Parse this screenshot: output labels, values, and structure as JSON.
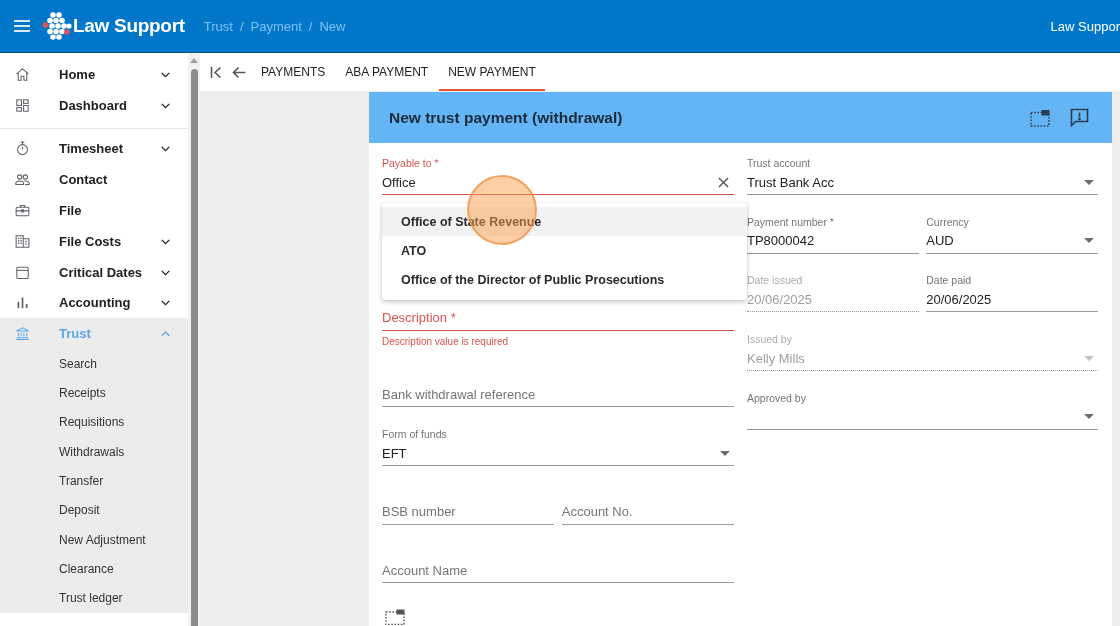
{
  "header": {
    "app_name": "Law Support",
    "breadcrumb": [
      {
        "label": "Trust",
        "separator": "/"
      },
      {
        "label": "Payment",
        "separator": "/"
      },
      {
        "label": "New"
      }
    ],
    "user": "Law Suppor"
  },
  "sidebar": {
    "sections": [
      {
        "items": [
          {
            "label": "Home",
            "expandable": true,
            "expanded": false,
            "selected": false
          },
          {
            "label": "Dashboard",
            "expandable": true,
            "expanded": false,
            "selected": false
          }
        ]
      },
      {
        "items": [
          {
            "label": "Timesheet",
            "expandable": true,
            "expanded": false,
            "selected": false
          },
          {
            "label": "Contact",
            "expandable": false,
            "expanded": false,
            "selected": false
          },
          {
            "label": "File",
            "expandable": false,
            "expanded": false,
            "selected": false
          },
          {
            "label": "File Costs",
            "expandable": true,
            "expanded": false,
            "selected": false
          },
          {
            "label": "Critical Dates",
            "expandable": true,
            "expanded": false,
            "selected": false
          },
          {
            "label": "Accounting",
            "expandable": true,
            "expanded": false,
            "selected": false
          },
          {
            "label": "Trust",
            "expandable": true,
            "expanded": true,
            "selected": true,
            "children": [
              {
                "label": "Search",
                "selected": false
              },
              {
                "label": "Receipts",
                "selected": false
              },
              {
                "label": "Requisitions",
                "selected": false
              },
              {
                "label": "Withdrawals",
                "selected": false
              },
              {
                "label": "Transfer",
                "selected": false
              },
              {
                "label": "Deposit",
                "selected": false
              },
              {
                "label": "New Adjustment",
                "selected": false
              },
              {
                "label": "Clearance",
                "selected": false
              },
              {
                "label": "Trust ledger",
                "selected": false
              }
            ]
          }
        ]
      }
    ]
  },
  "tabs": [
    {
      "label": "PAYMENTS",
      "selected": false
    },
    {
      "label": "ABA PAYMENT",
      "selected": false
    },
    {
      "label": "NEW PAYMENT",
      "selected": true
    }
  ],
  "form": {
    "title": "New trust payment (withdrawal)",
    "columns": [
      {
        "rows": [
          {
            "fields": [
              {
                "kind": "autocomplete",
                "label": "Payable to *",
                "value": "Office",
                "invalid": true,
                "disabled": false,
                "suggestions": [
                  {
                    "label": "Office of State Revenue",
                    "selected": true
                  },
                  {
                    "label": "ATO",
                    "selected": false
                  },
                  {
                    "label": "Office of the Director of Public Prosecutions",
                    "selected": false
                  }
                ]
              }
            ]
          },
          {
            "fields": [
              {
                "kind": "text",
                "placeholder": "Description *",
                "error": "Description value is required",
                "invalid": true,
                "disabled": false
              }
            ]
          },
          {
            "fields": [
              {
                "kind": "text",
                "placeholder": "Bank withdrawal reference",
                "invalid": false,
                "disabled": false
              }
            ]
          },
          {
            "fields": [
              {
                "kind": "select",
                "label": "Form of funds",
                "value": "EFT",
                "invalid": false,
                "disabled": false
              }
            ]
          },
          {
            "fields": [
              {
                "kind": "text",
                "placeholder": "BSB number",
                "invalid": false,
                "disabled": false
              },
              {
                "kind": "text",
                "placeholder": "Account No.",
                "invalid": false,
                "disabled": false
              }
            ]
          },
          {
            "fields": [
              {
                "kind": "text",
                "placeholder": "Account Name",
                "invalid": false,
                "disabled": false
              }
            ]
          }
        ]
      },
      {
        "rows": [
          {
            "fields": [
              {
                "kind": "select",
                "label": "Trust account",
                "value": "Trust Bank Acc",
                "invalid": false,
                "disabled": false
              }
            ]
          },
          {
            "fields": [
              {
                "kind": "text",
                "label": "Payment number *",
                "value": "TP8000042",
                "invalid": false,
                "disabled": false
              },
              {
                "kind": "select",
                "label": "Currency",
                "value": "AUD",
                "invalid": false,
                "disabled": false
              }
            ]
          },
          {
            "fields": [
              {
                "kind": "text",
                "label": "Date issued",
                "value": "20/06/2025",
                "invalid": false,
                "disabled": true
              },
              {
                "kind": "text",
                "label": "Date paid",
                "value": "20/06/2025",
                "invalid": false,
                "disabled": false
              }
            ]
          },
          {
            "fields": [
              {
                "kind": "select",
                "label": "Issued by",
                "value": "Kelly Mills",
                "invalid": false,
                "disabled": true
              }
            ]
          },
          {
            "fields": [
              {
                "kind": "select",
                "label": "Approved by",
                "invalid": false,
                "disabled": false
              }
            ]
          }
        ]
      }
    ]
  }
}
